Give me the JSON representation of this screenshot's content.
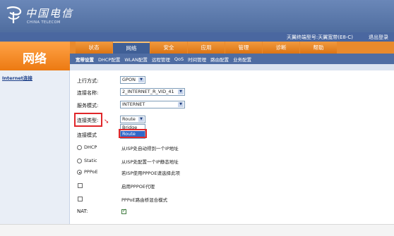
{
  "brand": {
    "name_cn": "中国电信",
    "name_en": "CHINA TELECOM"
  },
  "info_bar": {
    "device_info": "天翼终端型号:天翼宽带(E8-C)",
    "logout": "退出登录"
  },
  "section": {
    "title": "网络"
  },
  "main_nav": [
    {
      "label": "状态"
    },
    {
      "label": "网络"
    },
    {
      "label": "安全"
    },
    {
      "label": "应用"
    },
    {
      "label": "管理"
    },
    {
      "label": "诊断"
    },
    {
      "label": "帮助"
    }
  ],
  "sub_nav": [
    {
      "label": "宽带设置"
    },
    {
      "label": "DHCP配置"
    },
    {
      "label": "WLAN配置"
    },
    {
      "label": "远程管理"
    },
    {
      "label": "QoS"
    },
    {
      "label": "时间管理"
    },
    {
      "label": "路由配置"
    },
    {
      "label": "业务配置"
    }
  ],
  "left_panel": {
    "link": "Internet连接"
  },
  "form": {
    "upstream_label": "上行方式:",
    "upstream_value": "GPON",
    "conn_name_label": "连接名称:",
    "conn_name_value": "2_INTERNET_R_VID_41",
    "service_mode_label": "服务模式:",
    "service_mode_value": "INTERNET",
    "conn_type_label": "连接类型:",
    "conn_type_value": "Route",
    "conn_type_options": [
      "Bridge",
      "Route"
    ],
    "conn_mode_label": "连接模式",
    "dhcp_label": "DHCP",
    "dhcp_desc": "从ISP处自动得到一个IP地址",
    "static_label": "Static",
    "static_desc": "从ISP处配置一个IP静态地址",
    "pppoe_label": "PPPoE",
    "pppoe_desc": "若ISP使用PPPOE请选择此项",
    "pppoe_proxy_desc": "启用PPPOE代理",
    "pppoe_bridge_desc": "PPPoE路由桥混合模式",
    "nat_label": "NAT:",
    "nat_checked": true
  },
  "colors": {
    "header_blue": "#5a78ad",
    "orange": "#ec8a2b",
    "highlight": "#e0262a"
  }
}
